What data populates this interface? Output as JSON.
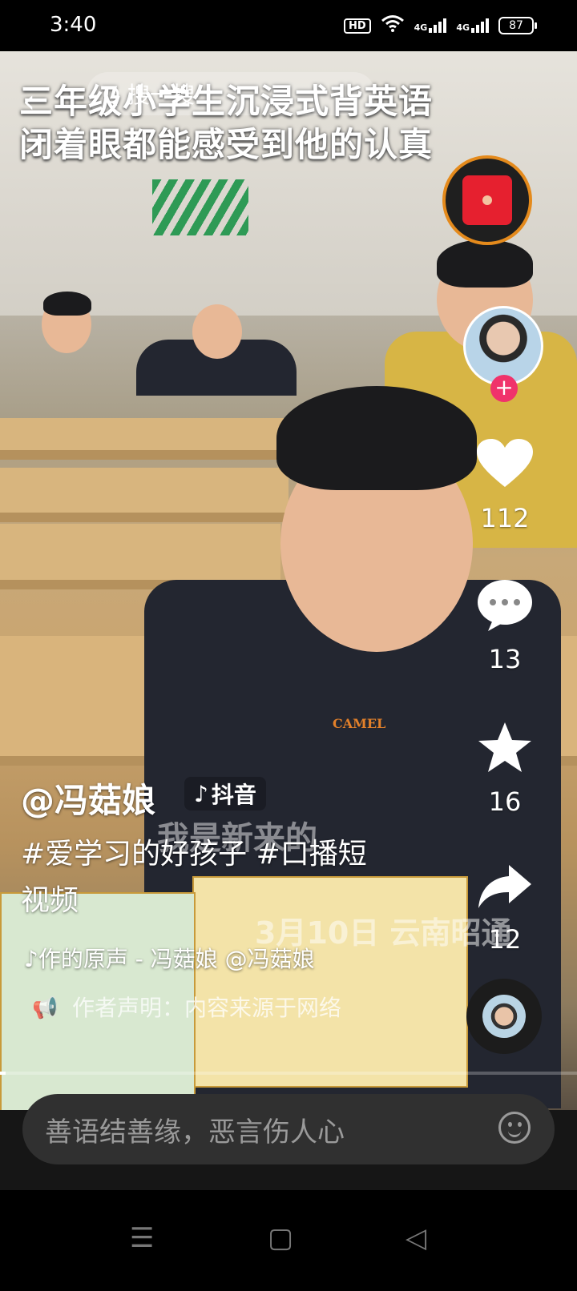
{
  "status_bar": {
    "time": "3:40",
    "hd": "HD",
    "net1": "4G",
    "net2": "4G",
    "battery": "87"
  },
  "top": {
    "search_text": "Q 搜一搜",
    "title_line1": "三年级小学生沉浸式背英语",
    "title_line2": "闭着眼都能感受到他的认真"
  },
  "side": {
    "likes": "112",
    "comments": "13",
    "favorites": "16",
    "shares": "12"
  },
  "post": {
    "author": "@冯菇娘",
    "douyin_tag": "抖音",
    "description": "#爱学习的好孩子 #口播短视频",
    "music": "♪作的原声 - 冯菇娘    @冯菇娘",
    "statement": "作者声明：内容来源于网络"
  },
  "video_text": {
    "subtitle": "我是新来的",
    "date_location": "3月10日 云南昭通",
    "jacket_brand": "CAMEL"
  },
  "progress": 0.01,
  "comment_bar": {
    "placeholder": "善语结善缘，恶言伤人心"
  },
  "icons": [
    "back-arrow-icon",
    "heart-icon",
    "comment-icon",
    "star-icon",
    "share-icon",
    "red-packet-icon",
    "music-disc-icon",
    "megaphone-icon",
    "emoji-icon",
    "menu-icon",
    "home-icon",
    "back-nav-icon"
  ]
}
